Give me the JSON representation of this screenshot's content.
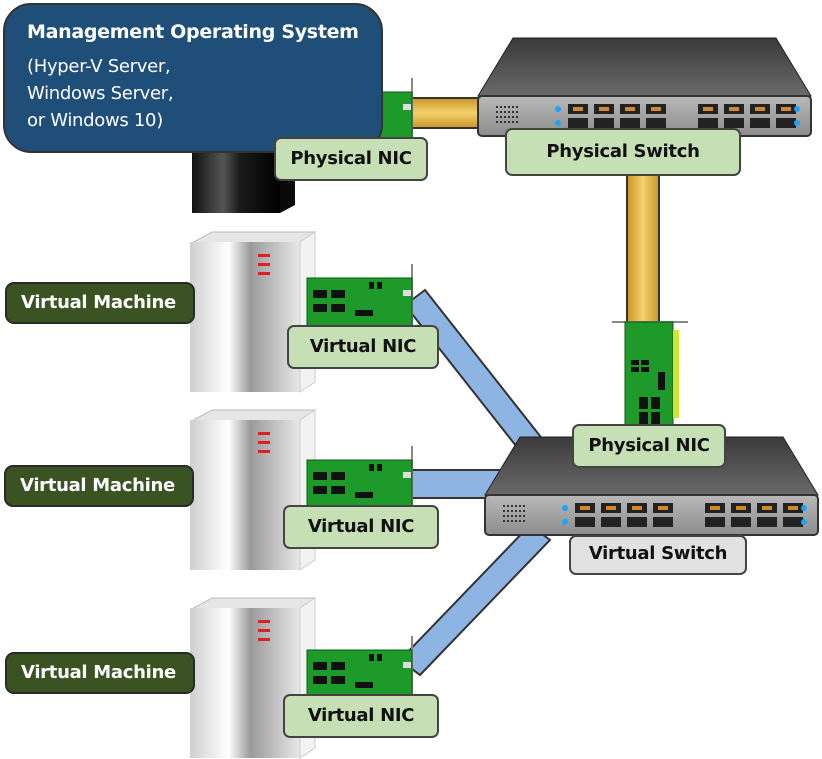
{
  "management": {
    "title": "Management Operating System",
    "lines": [
      "(Hyper-V Server,",
      "Windows Server,",
      "or Windows 10)"
    ]
  },
  "physical_switch": {
    "label": "Physical Switch"
  },
  "virtual_switch": {
    "label": "Virtual Switch"
  },
  "physical_nic_host": {
    "label": "Physical NIC"
  },
  "physical_nic_switch": {
    "label": "Physical NIC"
  },
  "virtual_machines": [
    {
      "label": "Virtual Machine",
      "nic_label": "Virtual NIC"
    },
    {
      "label": "Virtual Machine",
      "nic_label": "Virtual NIC"
    },
    {
      "label": "Virtual Machine",
      "nic_label": "Virtual NIC"
    }
  ],
  "colors": {
    "management_bg": "#1f4e79",
    "vm_label_bg": "#3b5323",
    "label_green": "#c6dfb4",
    "label_grey": "#e1e1e1",
    "physical_cable": "#e8b84a",
    "virtual_cable": "#8db4e2",
    "nic_board": "#1e9a2a",
    "host_led": "#3b4bd6",
    "vm_led": "#e02020",
    "port_led": "#1aa3ff"
  }
}
